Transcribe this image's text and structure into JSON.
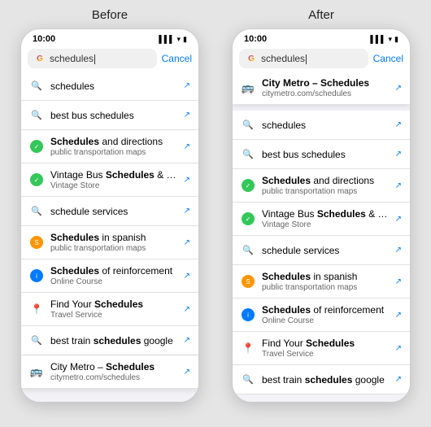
{
  "labels": {
    "before": "Before",
    "after": "After"
  },
  "phone_before": {
    "status": {
      "time": "10:00",
      "signal": "▌▌▌",
      "wifi": "WiFi",
      "battery": "🔋"
    },
    "search": {
      "text": "schedules",
      "cancel": "Cancel"
    },
    "suggestions": [
      {
        "type": "search",
        "main": "schedules",
        "bold_parts": [],
        "sub": "",
        "arrow": true
      },
      {
        "type": "search",
        "main": "best bus schedules",
        "bold_parts": [],
        "sub": "",
        "arrow": true
      },
      {
        "type": "green",
        "main": "Schedules and directions",
        "bold_parts": [
          "Schedules"
        ],
        "sub": "public transportation maps",
        "arrow": true
      },
      {
        "type": "green",
        "main": "Vintage Bus Schedules & Maps",
        "bold_parts": [
          "Schedules"
        ],
        "sub": "Vintage Store",
        "arrow": true
      },
      {
        "type": "search",
        "main": "schedule services",
        "bold_parts": [],
        "sub": "",
        "arrow": true
      },
      {
        "type": "orange",
        "main": "Schedules in spanish",
        "bold_parts": [
          "Schedules"
        ],
        "sub": "public transportation maps",
        "arrow": true
      },
      {
        "type": "blue",
        "main": "Schedules of reinforcement",
        "bold_parts": [
          "Schedules"
        ],
        "sub": "Online Course",
        "arrow": true
      },
      {
        "type": "red",
        "main": "Find Your Schedules",
        "bold_parts": [
          "Schedules"
        ],
        "sub": "Travel Service",
        "arrow": true
      },
      {
        "type": "search",
        "main": "best train schedules google",
        "bold_parts": [
          "schedules"
        ],
        "sub": "",
        "arrow": true
      },
      {
        "type": "bus",
        "main": "City Metro – Schedules",
        "bold_parts": [
          "Schedules"
        ],
        "sub": "citymetro.com/schedules",
        "arrow": true,
        "elevated": true
      }
    ]
  },
  "phone_after": {
    "status": {
      "time": "10:00"
    },
    "search": {
      "text": "schedules",
      "cancel": "Cancel"
    },
    "suggestions": [
      {
        "type": "bus",
        "main": "City Metro – Schedules",
        "bold_parts": [
          "Schedules"
        ],
        "sub": "citymetro.com/schedules",
        "arrow": true,
        "elevated": true
      },
      {
        "type": "search",
        "main": "schedules",
        "bold_parts": [],
        "sub": "",
        "arrow": true
      },
      {
        "type": "search",
        "main": "best bus schedules",
        "bold_parts": [],
        "sub": "",
        "arrow": true
      },
      {
        "type": "green",
        "main": "Schedules and directions",
        "bold_parts": [
          "Schedules"
        ],
        "sub": "public transportation maps",
        "arrow": true
      },
      {
        "type": "green",
        "main": "Vintage Bus Schedules & Maps",
        "bold_parts": [
          "Schedules"
        ],
        "sub": "Vintage Store",
        "arrow": true
      },
      {
        "type": "search",
        "main": "schedule services",
        "bold_parts": [],
        "sub": "",
        "arrow": true
      },
      {
        "type": "orange",
        "main": "Schedules in spanish",
        "bold_parts": [
          "Schedules"
        ],
        "sub": "public transportation maps",
        "arrow": true
      },
      {
        "type": "blue",
        "main": "Schedules of reinforcement",
        "bold_parts": [
          "Schedules"
        ],
        "sub": "Online Course",
        "arrow": true
      },
      {
        "type": "red",
        "main": "Find Your Schedules",
        "bold_parts": [
          "Schedules"
        ],
        "sub": "Travel Service",
        "arrow": true
      },
      {
        "type": "search",
        "main": "best train schedules google",
        "bold_parts": [
          "schedules"
        ],
        "sub": "",
        "arrow": true
      }
    ]
  }
}
